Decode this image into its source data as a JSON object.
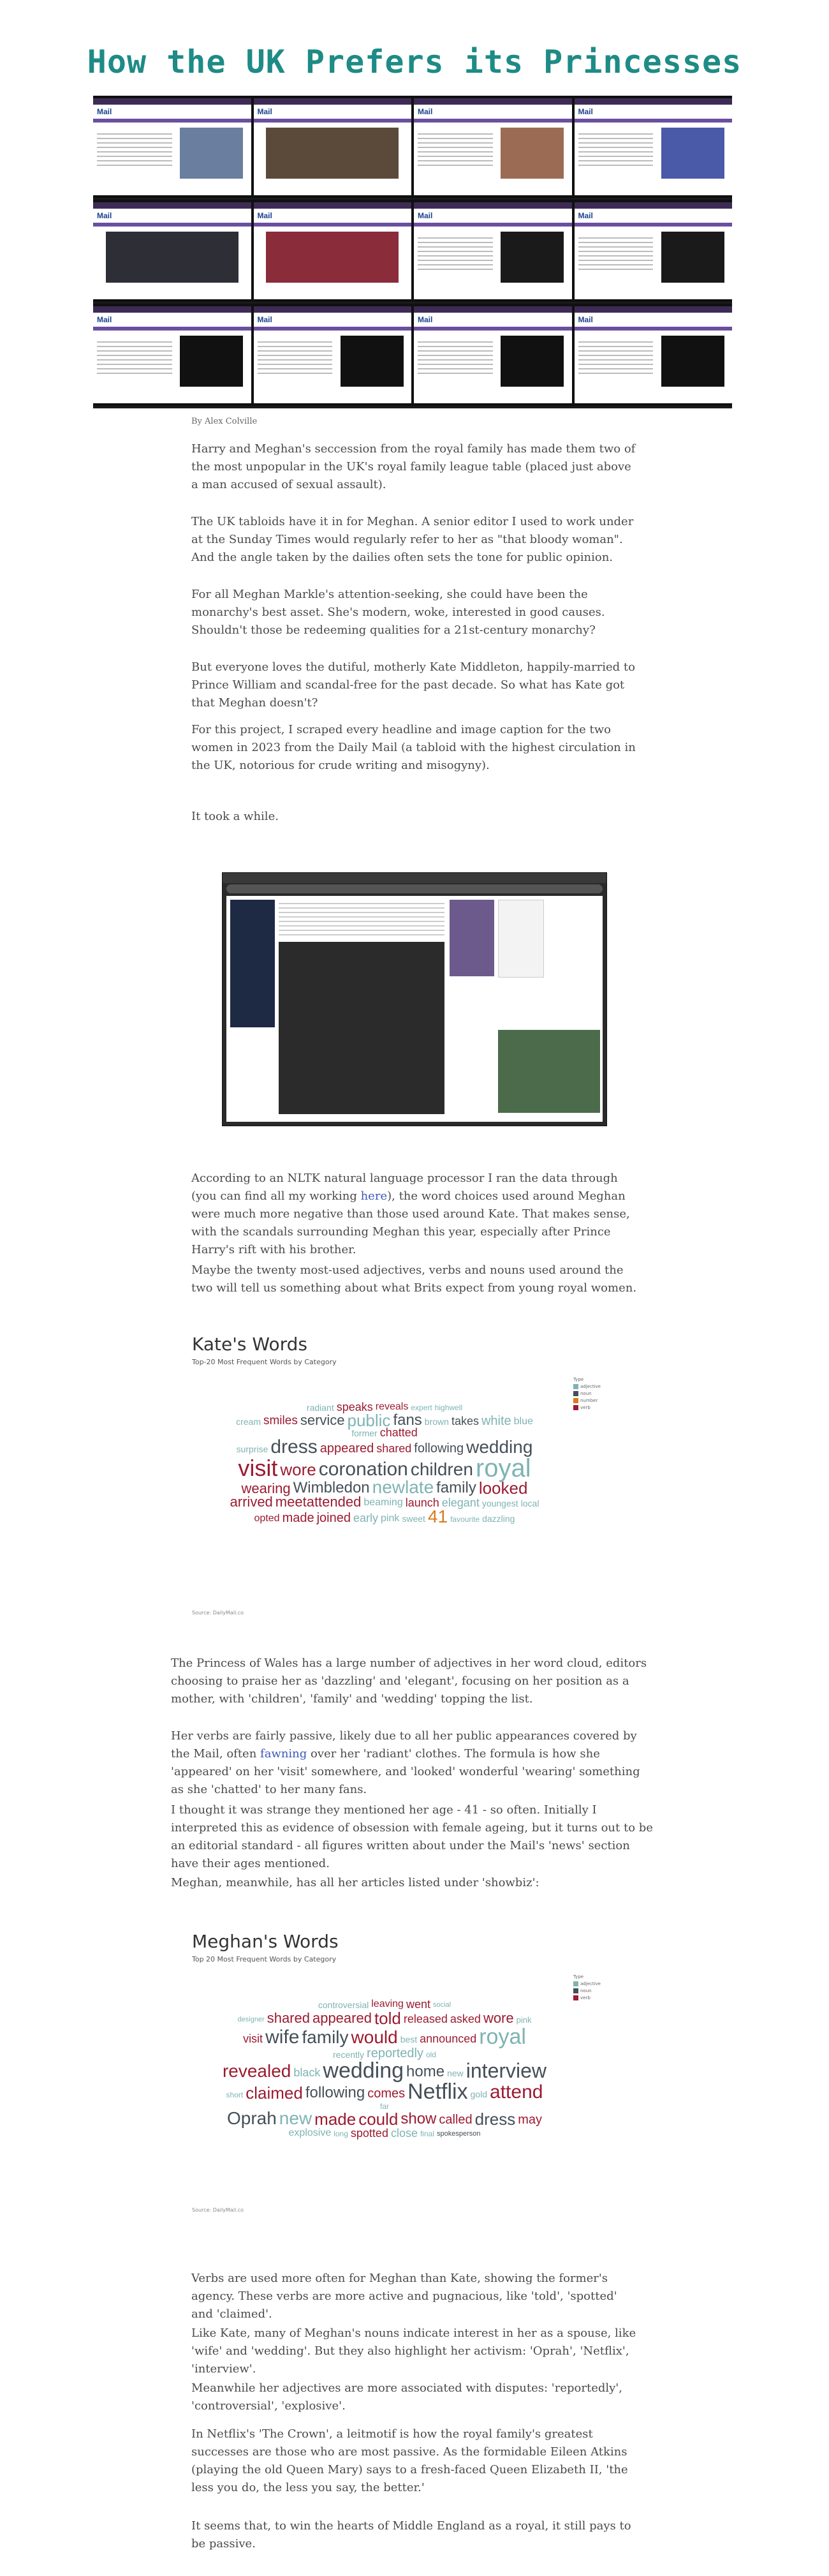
{
  "page": {
    "title": "How the UK Prefers its Princesses",
    "byline": "By Alex Colville"
  },
  "colors": {
    "title": "#1e8b86",
    "adjective": "#7fb3b3",
    "noun": "#454f57",
    "verb": "#9b1b30",
    "link": "#3b58b8"
  },
  "intro": [
    "Harry and Meghan's seccession from the royal family has made them two of the most unpopular in the UK's royal family league table (placed just above a man accused of sexual assault).",
    "The UK tabloids have it in for Meghan. A senior editor I used to work under at the Sunday Times would regularly refer to her as \"that bloody woman\". And the angle taken by the dailies often sets the tone for public opinion.",
    "For all Meghan Markle's attention-seeking, she could have been the monarchy's best asset. She's modern, woke, interested in good causes. Shouldn't those be redeeming qualities for a 21st-century monarchy?",
    "But everyone loves the dutiful, motherly Kate Middleton, happily-married to Prince William and scandal-free for the past decade. So what has Kate got that Meghan doesn't?",
    "For this project, I scraped every headline and image caption for the two women in 2023 from the Daily Mail (a tabloid with the highest circulation in the UK, notorious for crude writing and misogyny).",
    "It took a while."
  ],
  "nltk": {
    "before": "According to an NLTK natural language processor I ran the data through (you can find all my working ",
    "link": "here",
    "after": "), the word choices used around Meghan were much more negative than those used around Kate. That makes sense, with the scandals surrounding Meghan this year, especially after Prince Harry's rift with his brother."
  },
  "nltk2": "Maybe the twenty most-used adjectives, verbs and nouns used around the two will tell us something about what Brits expect from young royal women.",
  "kate_chart": {
    "title": "Kate's Words",
    "subtitle": "Top-20 Most Frequent Words by Category",
    "source": "Source: DailyMail.co",
    "legend_title": "Type",
    "legend": [
      "adjective",
      "noun",
      "number",
      "verb"
    ],
    "legend_colors": [
      "#7fb3b3",
      "#454f57",
      "#d97a1e",
      "#9b1b30"
    ]
  },
  "kate_words": [
    {
      "w": "radiant",
      "t": "a",
      "s": 14
    },
    {
      "w": "speaks",
      "t": "v",
      "s": 18
    },
    {
      "w": "reveals",
      "t": "v",
      "s": 16
    },
    {
      "w": "expert",
      "t": "a",
      "s": 12
    },
    {
      "w": "highwell",
      "t": "a",
      "s": 12
    },
    {
      "w": "cream",
      "t": "a",
      "s": 14
    },
    {
      "w": "smiles",
      "t": "v",
      "s": 19
    },
    {
      "w": "service",
      "t": "n",
      "s": 22
    },
    {
      "w": "public",
      "t": "a",
      "s": 26
    },
    {
      "w": "fans",
      "t": "n",
      "s": 24
    },
    {
      "w": "brown",
      "t": "a",
      "s": 14
    },
    {
      "w": "takes",
      "t": "n",
      "s": 18
    },
    {
      "w": "white",
      "t": "a",
      "s": 20
    },
    {
      "w": "blue",
      "t": "a",
      "s": 16
    },
    {
      "w": "former",
      "t": "a",
      "s": 14
    },
    {
      "w": "chatted",
      "t": "v",
      "s": 18
    },
    {
      "w": "surprise",
      "t": "a",
      "s": 14
    },
    {
      "w": "dress",
      "t": "n",
      "s": 30
    },
    {
      "w": "appeared",
      "t": "v",
      "s": 20
    },
    {
      "w": "shared",
      "t": "v",
      "s": 18
    },
    {
      "w": "following",
      "t": "n",
      "s": 20
    },
    {
      "w": "wedding",
      "t": "n",
      "s": 28
    },
    {
      "w": "visit",
      "t": "v",
      "s": 36
    },
    {
      "w": "wore",
      "t": "v",
      "s": 26
    },
    {
      "w": "coronation",
      "t": "n",
      "s": 30
    },
    {
      "w": "children",
      "t": "n",
      "s": 28
    },
    {
      "w": "royal",
      "t": "a",
      "s": 40
    },
    {
      "w": "wearing",
      "t": "v",
      "s": 22
    },
    {
      "w": "Wimbledon",
      "t": "n",
      "s": 24
    },
    {
      "w": "newlate",
      "t": "a",
      "s": 28
    },
    {
      "w": "family",
      "t": "n",
      "s": 24
    },
    {
      "w": "looked",
      "t": "v",
      "s": 26
    },
    {
      "w": "arrived",
      "t": "v",
      "s": 22
    },
    {
      "w": "meetattended",
      "t": "v",
      "s": 22
    },
    {
      "w": "beaming",
      "t": "a",
      "s": 16
    },
    {
      "w": "launch",
      "t": "v",
      "s": 18
    },
    {
      "w": "elegant",
      "t": "a",
      "s": 18
    },
    {
      "w": "youngest",
      "t": "a",
      "s": 14
    },
    {
      "w": "local",
      "t": "a",
      "s": 14
    },
    {
      "w": "opted",
      "t": "v",
      "s": 16
    },
    {
      "w": "made",
      "t": "v",
      "s": 20
    },
    {
      "w": "joined",
      "t": "v",
      "s": 20
    },
    {
      "w": "early",
      "t": "a",
      "s": 18
    },
    {
      "w": "pink",
      "t": "a",
      "s": 16
    },
    {
      "w": "sweet",
      "t": "a",
      "s": 14
    },
    {
      "w": "41",
      "t": "num",
      "s": 28
    },
    {
      "w": "favourite",
      "t": "a",
      "s": 12
    },
    {
      "w": "dazzling",
      "t": "a",
      "s": 14
    }
  ],
  "kate_text": {
    "p1": "The Princess of Wales has a large number of adjectives in her word cloud, editors choosing to praise her as 'dazzling' and 'elegant', focusing on her position as a mother, with 'children', 'family' and 'wedding' topping the list.",
    "p2_link": "fawning",
    "p2_before": "Her verbs are fairly passive, likely due to all her public appearances covered by the Mail, often ",
    "p2_after": " over her 'radiant' clothes. The formula is how she 'appeared' on her 'visit' somewhere, and 'looked' wonderful 'wearing' something as she 'chatted' to her many fans.",
    "p3": "I thought it was strange they mentioned her age - 41 - so often. Initially I interpreted this as evidence of obsession with female ageing, but it turns out to be an editorial standard - all figures written about under the Mail's 'news' section have their ages mentioned.",
    "p4": "Meghan, meanwhile, has all her articles listed under 'showbiz':"
  },
  "meghan_chart": {
    "title": "Meghan's Words",
    "subtitle": "Top 20 Most Frequent Words by Category",
    "source": "Source: DailyMail.co",
    "legend_title": "Type",
    "legend": [
      "adjective",
      "noun",
      "verb"
    ],
    "legend_colors": [
      "#7fb3b3",
      "#454f57",
      "#9b1b30"
    ]
  },
  "meghan_words": [
    {
      "w": "controversial",
      "t": "a",
      "s": 14
    },
    {
      "w": "leaving",
      "t": "v",
      "s": 16
    },
    {
      "w": "went",
      "t": "v",
      "s": 18
    },
    {
      "w": "social",
      "t": "a",
      "s": 11
    },
    {
      "w": "designer",
      "t": "a",
      "s": 11
    },
    {
      "w": "shared",
      "t": "v",
      "s": 22
    },
    {
      "w": "appeared",
      "t": "v",
      "s": 22
    },
    {
      "w": "told",
      "t": "v",
      "s": 26
    },
    {
      "w": "released",
      "t": "v",
      "s": 18
    },
    {
      "w": "asked",
      "t": "v",
      "s": 18
    },
    {
      "w": "wore",
      "t": "v",
      "s": 22
    },
    {
      "w": "pink",
      "t": "a",
      "s": 13
    },
    {
      "w": "visit",
      "t": "v",
      "s": 18
    },
    {
      "w": "wife",
      "t": "n",
      "s": 30
    },
    {
      "w": "family",
      "t": "n",
      "s": 28
    },
    {
      "w": "would",
      "t": "v",
      "s": 28
    },
    {
      "w": "best",
      "t": "a",
      "s": 14
    },
    {
      "w": "announced",
      "t": "v",
      "s": 18
    },
    {
      "w": "royal",
      "t": "a",
      "s": 34
    },
    {
      "w": "recently",
      "t": "a",
      "s": 14
    },
    {
      "w": "reportedly",
      "t": "a",
      "s": 20
    },
    {
      "w": "old",
      "t": "a",
      "s": 12
    },
    {
      "w": "revealed",
      "t": "v",
      "s": 28
    },
    {
      "w": "black",
      "t": "a",
      "s": 18
    },
    {
      "w": "wedding",
      "t": "n",
      "s": 34
    },
    {
      "w": "home",
      "t": "n",
      "s": 24
    },
    {
      "w": "new",
      "t": "a",
      "s": 14
    },
    {
      "w": "interview",
      "t": "n",
      "s": 32
    },
    {
      "w": "short",
      "t": "a",
      "s": 12
    },
    {
      "w": "claimed",
      "t": "v",
      "s": 26
    },
    {
      "w": "following",
      "t": "n",
      "s": 24
    },
    {
      "w": "comes",
      "t": "v",
      "s": 20
    },
    {
      "w": "Netflix",
      "t": "n",
      "s": 34
    },
    {
      "w": "gold",
      "t": "a",
      "s": 14
    },
    {
      "w": "attend",
      "t": "v",
      "s": 30
    },
    {
      "w": "far",
      "t": "a",
      "s": 12
    },
    {
      "w": "Oprah",
      "t": "n",
      "s": 28
    },
    {
      "w": "new",
      "t": "a",
      "s": 28
    },
    {
      "w": "made",
      "t": "v",
      "s": 26
    },
    {
      "w": "could",
      "t": "v",
      "s": 26
    },
    {
      "w": "show",
      "t": "v",
      "s": 24
    },
    {
      "w": "called",
      "t": "v",
      "s": 20
    },
    {
      "w": "dress",
      "t": "n",
      "s": 26
    },
    {
      "w": "may",
      "t": "v",
      "s": 20
    },
    {
      "w": "explosive",
      "t": "a",
      "s": 16
    },
    {
      "w": "long",
      "t": "a",
      "s": 12
    },
    {
      "w": "spotted",
      "t": "v",
      "s": 18
    },
    {
      "w": "close",
      "t": "a",
      "s": 18
    },
    {
      "w": "final",
      "t": "a",
      "s": 12
    },
    {
      "w": "spokesperson",
      "t": "n",
      "s": 11
    }
  ],
  "meghan_text": [
    "Verbs are used more often for Meghan than Kate, showing the former's agency. These verbs are more active and pugnacious, like 'told', 'spotted' and 'claimed'.",
    "Like Kate, many of Meghan's nouns indicate interest in her as a spouse, like 'wife' and 'wedding'. But they also highlight her activism: 'Oprah', 'Netflix', 'interview'.",
    "Meanwhile her adjectives are more associated with disputes: 'reportedly', 'controversial', 'explosive'.",
    "In Netflix's 'The Crown', a leitmotif is how the royal family's greatest successes are those who are most passive. As the formidable Eileen Atkins (playing the old Queen Mary) says to a fresh-faced Queen Elizabeth II, 'the less you do, the less you say, the better.'",
    "It seems that, to win the hearts of Middle England as a royal, it still pays to be passive."
  ]
}
